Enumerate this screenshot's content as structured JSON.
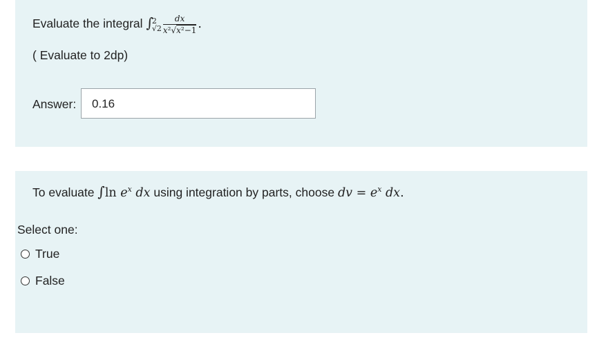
{
  "question1": {
    "prefix": "Evaluate the integral",
    "integrand_num": "dx",
    "lower": "√2",
    "upper": "2",
    "note": "( Evaluate to 2dp)",
    "answer_label": "Answer:",
    "answer_value": "0.16"
  },
  "question2": {
    "prefix": "To evaluate",
    "middle": "using integration by parts, choose",
    "select_label": "Select one:",
    "options": [
      {
        "label": "True"
      },
      {
        "label": "False"
      }
    ]
  }
}
